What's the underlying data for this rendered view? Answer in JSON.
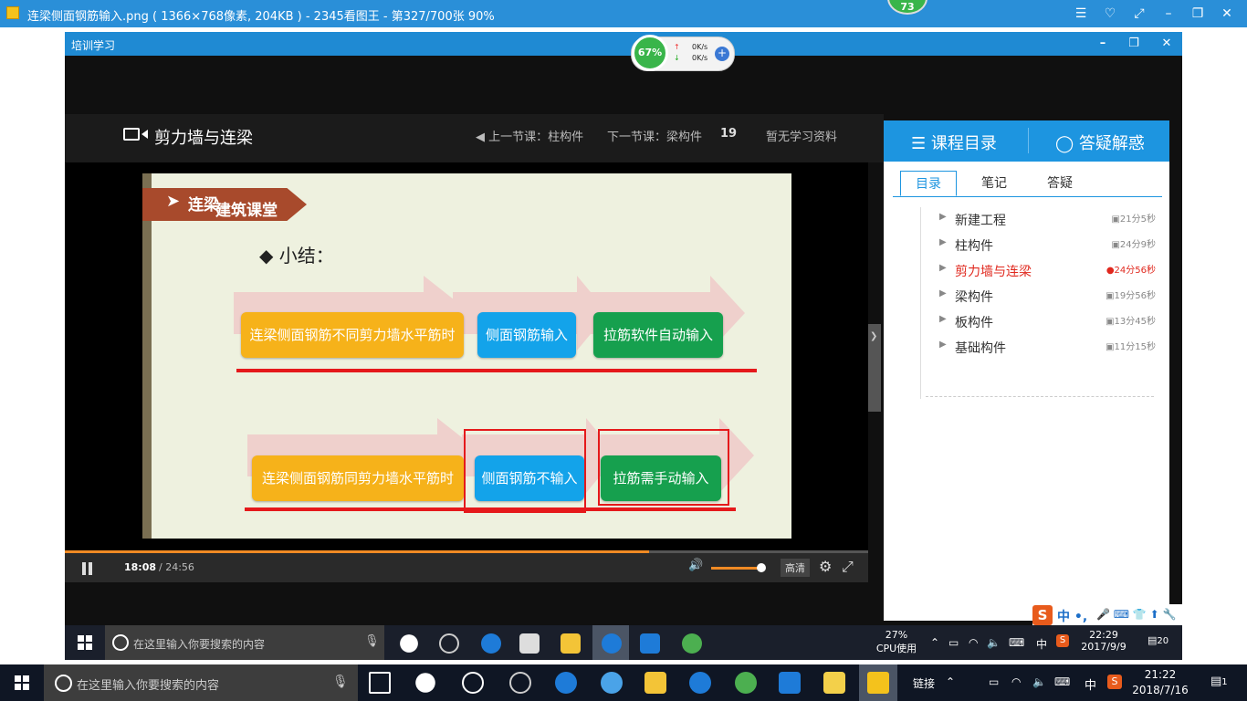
{
  "viewer": {
    "title": "连梁侧面钢筋输入.png ( 1366×768像素, 204KB ) - 2345看图王 - 第327/700张 90%",
    "badge": "73",
    "controls": {
      "menu": "☰",
      "skin": "♡",
      "fullscreen": "⤢",
      "minimize": "–",
      "restore": "❐",
      "close": "✕"
    }
  },
  "app": {
    "window_title": "培训学习",
    "controls": {
      "minimize": "–",
      "restore": "❐",
      "close": "✕"
    },
    "speed_widget": {
      "percent": "67%",
      "up": "0K/s",
      "down": "0K/s",
      "plus": "+"
    }
  },
  "course_header": {
    "title": "剪力墙与连梁",
    "prev_lesson": "◀ 上一节课：柱构件",
    "next_lesson": "下一节课：梁构件",
    "count": "19",
    "materials": "暂无学习资料"
  },
  "slide": {
    "banner": "连梁",
    "logo": "建筑课堂",
    "heading": "◆ 小结：",
    "row1": {
      "a": "连梁侧面钢筋不同剪力墙水平筋时",
      "b": "侧面钢筋输入",
      "c": "拉筋软件自动输入"
    },
    "row2": {
      "a": "连梁侧面钢筋同剪力墙水平筋时",
      "b": "侧面钢筋不输入",
      "c": "拉筋需手动输入"
    },
    "colors": {
      "yellow": "#f6b21a",
      "blue": "#13a3ea",
      "green": "#16a04e",
      "annotation_red": "#e5191b"
    }
  },
  "player": {
    "time_current": "18:08",
    "time_total": "/ 24:56",
    "progress_fraction": 0.727,
    "volume_fraction": 0.9,
    "quality": "高清",
    "volume_icon": "🔊",
    "settings_icon": "⚙",
    "fullscreen_icon": "⤢"
  },
  "side_panel": {
    "header_tabs": [
      {
        "icon": "☰",
        "label": "课程目录"
      },
      {
        "icon": "◯",
        "label": "答疑解惑"
      }
    ],
    "tabs": [
      "目录",
      "笔记",
      "答疑"
    ],
    "active_tab": "目录",
    "items": [
      {
        "name": "新建工程",
        "duration": "21分5秒",
        "current": false
      },
      {
        "name": "柱构件",
        "duration": "24分9秒",
        "current": false
      },
      {
        "name": "剪力墙与连梁",
        "duration": "24分56秒",
        "current": true
      },
      {
        "name": "梁构件",
        "duration": "19分56秒",
        "current": false
      },
      {
        "name": "板构件",
        "duration": "13分45秒",
        "current": false
      },
      {
        "name": "基础构件",
        "duration": "11分15秒",
        "current": false
      }
    ],
    "toggle_arrow": "❯",
    "ime": {
      "logo": "S",
      "mode": "中 •,",
      "icons": "🎤 ⌨ 👕 ⬆ 🔧"
    }
  },
  "inner_taskbar": {
    "search_placeholder": "在这里输入你要搜索的内容",
    "cpu_percent": "27%",
    "cpu_label": "CPU使用",
    "time": "22:29",
    "date": "2017/9/9",
    "ime": "中",
    "notif": "20"
  },
  "taskbar": {
    "search_placeholder": "在这里输入你要搜索的内容",
    "link_label": "链接",
    "ime": "中",
    "time": "21:22",
    "date": "2018/7/16",
    "notif": "1"
  }
}
